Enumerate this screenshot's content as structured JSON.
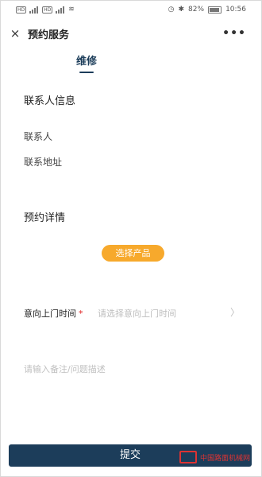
{
  "status_bar": {
    "left_icons": [
      "sim-icon",
      "signal-icon",
      "sim-icon",
      "signal-icon",
      "wifi-icon"
    ],
    "right_icons": [
      "alarm-icon",
      "bluetooth-icon"
    ],
    "battery": "82%",
    "time": "10:56"
  },
  "header": {
    "close_icon": "×",
    "title": "预约服务",
    "more_icon": "•••"
  },
  "tab": {
    "label": "维修"
  },
  "contact": {
    "title": "联系人信息",
    "person_label": "联系人",
    "address_label": "联系地址"
  },
  "details": {
    "title": "预约详情",
    "select_product_button": "选择产品",
    "visit_time_label": "意向上门时间",
    "required_mark": "*",
    "visit_time_placeholder": "请选择意向上门时间",
    "remark_placeholder": "请输入备注/问题描述"
  },
  "footer": {
    "submit_label": "提交",
    "watermark_text": "中国路面机械网"
  },
  "colors": {
    "accent": "#1c3d5a",
    "pill": "#f7a92c",
    "required": "#e02020"
  }
}
